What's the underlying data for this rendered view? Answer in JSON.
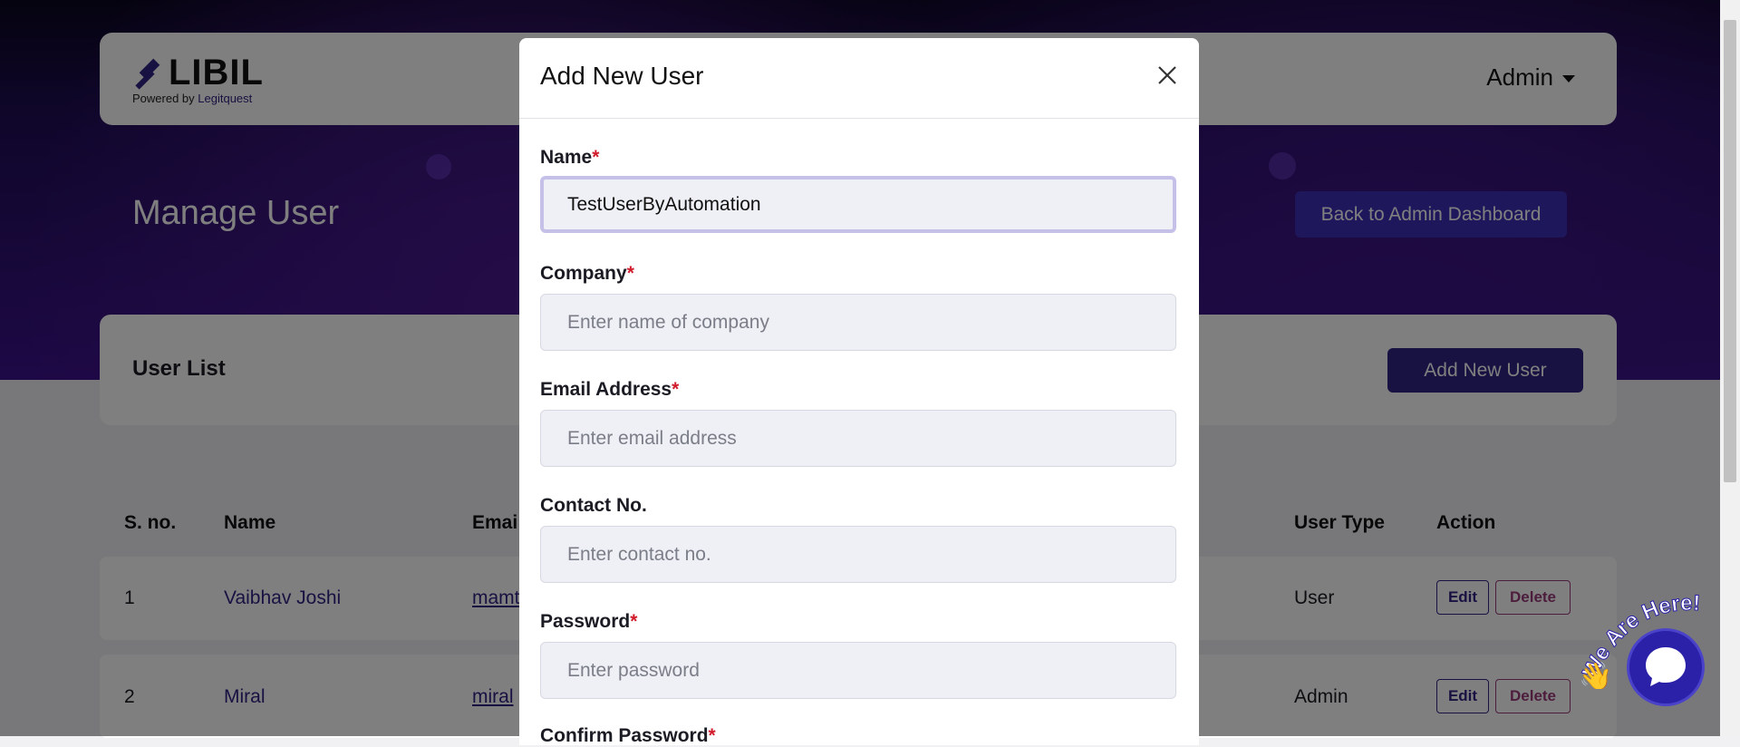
{
  "brand": {
    "logo_text": "LIBIL",
    "powered_prefix": "Powered by",
    "powered_brand": "Legitquest"
  },
  "nav": {
    "admin_label": "Admin"
  },
  "page": {
    "title": "Manage User",
    "back_button": "Back to Admin Dashboard"
  },
  "user_list": {
    "title": "User List",
    "add_button": "Add New User",
    "columns": [
      "S. no.",
      "Name",
      "Emai",
      "User Type",
      "Action"
    ],
    "rows": [
      {
        "sno": "1",
        "name": "Vaibhav Joshi",
        "email": "mamt",
        "type": "User",
        "edit": "Edit",
        "delete": "Delete"
      },
      {
        "sno": "2",
        "name": "Miral",
        "email": "miral",
        "type": "Admin",
        "edit": "Edit",
        "delete": "Delete"
      }
    ]
  },
  "modal": {
    "title": "Add New User",
    "fields": [
      {
        "label": "Name",
        "required": "*",
        "value": "TestUserByAutomation",
        "placeholder": ""
      },
      {
        "label": "Company",
        "required": "*",
        "value": "",
        "placeholder": "Enter name of company"
      },
      {
        "label": "Email Address",
        "required": "*",
        "value": "",
        "placeholder": "Enter email address"
      },
      {
        "label": "Contact No.",
        "required": "",
        "value": "",
        "placeholder": "Enter contact no."
      },
      {
        "label": "Password",
        "required": "*",
        "value": "",
        "placeholder": "Enter password"
      },
      {
        "label": "Confirm Password",
        "required": "*",
        "value": "",
        "placeholder": ""
      }
    ]
  },
  "chat": {
    "badge_text": "We Are Here!",
    "icon": "chat-icon"
  },
  "colors": {
    "primary": "#2e2584",
    "accent_button": "#3d2fb8",
    "required": "#d11a2a",
    "delete": "#9b3a7a"
  }
}
